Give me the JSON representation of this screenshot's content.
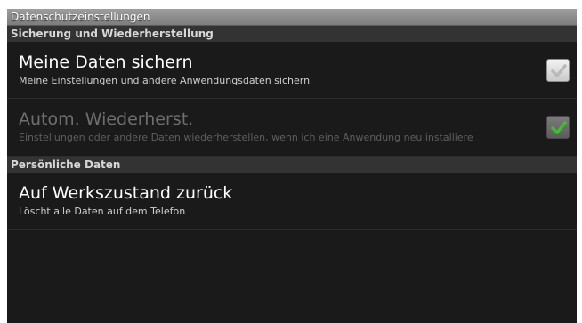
{
  "window": {
    "title": "Datenschutzeinstellungen"
  },
  "sections": [
    {
      "header": "Sicherung und Wiederherstellung",
      "items": [
        {
          "title": "Meine Daten sichern",
          "summary": "Meine Einstellungen und andere Anwendungsdaten sichern",
          "checked": false,
          "enabled": true
        },
        {
          "title": "Autom. Wiederherst.",
          "summary": "Einstellungen oder andere Daten wiederherstellen, wenn ich eine Anwendung neu installiere",
          "checked": true,
          "enabled": false
        }
      ]
    },
    {
      "header": "Persönliche Daten",
      "items": [
        {
          "title": "Auf Werkszustand zurück",
          "summary": "Löscht alle Daten auf dem Telefon"
        }
      ]
    }
  ],
  "colors": {
    "check_green": "#3fbf2f",
    "check_gray": "#b9b9b9"
  }
}
